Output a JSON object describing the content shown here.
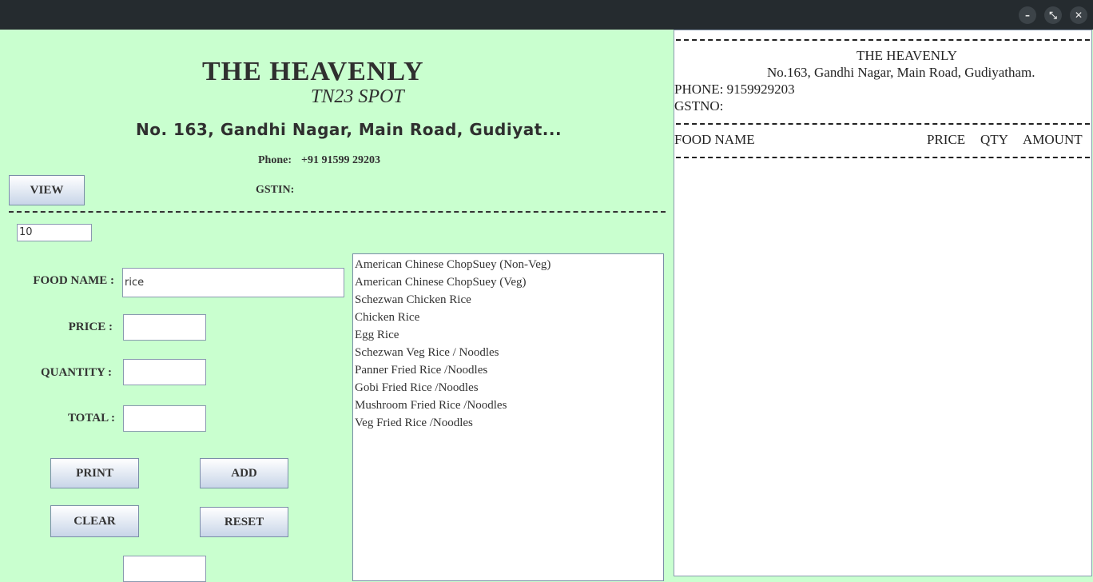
{
  "header": {
    "title": "THE HEAVENLY",
    "subtitle": "TN23 SPOT",
    "address": "No. 163, Gandhi Nagar, Main Road, Gudiyat...",
    "phone_label": "Phone:",
    "phone_value": "+91 91599 29203",
    "gstin_label": "GSTIN:",
    "view_button": "VIEW"
  },
  "form": {
    "small_field_value": "10",
    "food_name_label": "FOOD NAME :",
    "food_name_value": "rice",
    "price_label": "PRICE :",
    "price_value": "",
    "quantity_label": "QUANTITY :",
    "quantity_value": "",
    "total_label": "TOTAL :",
    "total_value": "",
    "bottom_value": "",
    "print_button": "PRINT",
    "add_button": "ADD",
    "clear_button": "CLEAR",
    "reset_button": "RESET"
  },
  "menu_list": [
    "American Chinese ChopSuey (Non-Veg)",
    "American Chinese ChopSuey (Veg)",
    "Schezwan Chicken Rice",
    "Chicken Rice",
    "Egg Rice",
    "Schezwan Veg Rice / Noodles",
    "Panner Fried Rice /Noodles",
    "Gobi Fried Rice /Noodles",
    "Mushroom Fried Rice /Noodles",
    "Veg Fried Rice /Noodles"
  ],
  "bill": {
    "name": "THE HEAVENLY",
    "address": "No.163, Gandhi Nagar, Main Road, Gudiyatham.",
    "phone": "PHONE: 9159929203",
    "gst": "GSTNO:",
    "col_food": "FOOD NAME",
    "col_price": "PRICE",
    "col_qty": "QTY",
    "col_amount": "AMOUNT"
  },
  "window": {
    "minimize": "–",
    "restore": "⤡",
    "close": "✕"
  }
}
